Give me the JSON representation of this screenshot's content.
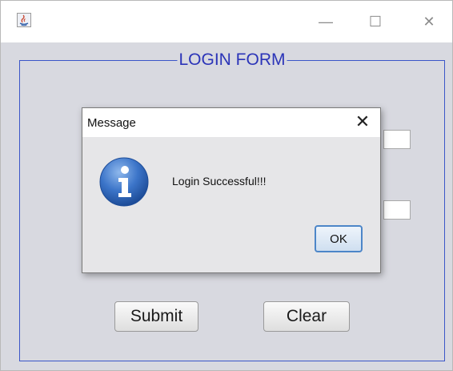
{
  "window": {
    "minimize_glyph": "—",
    "maximize_glyph": "☐",
    "close_glyph": "✕",
    "app_icon": "java-icon"
  },
  "form": {
    "legend": "LOGIN FORM",
    "submit_label": "Submit",
    "clear_label": "Clear",
    "username_value": "",
    "password_value": ""
  },
  "dialog": {
    "title": "Message",
    "close_glyph": "✕",
    "message": "Login Successful!!!",
    "ok_label": "OK",
    "icon": "info-icon"
  },
  "colors": {
    "legend": "#2b34b8",
    "border": "#3b56c8",
    "panel_bg": "#d8d9e0",
    "ok_border": "#4d86c8",
    "info_icon": "#2f6bbf"
  }
}
